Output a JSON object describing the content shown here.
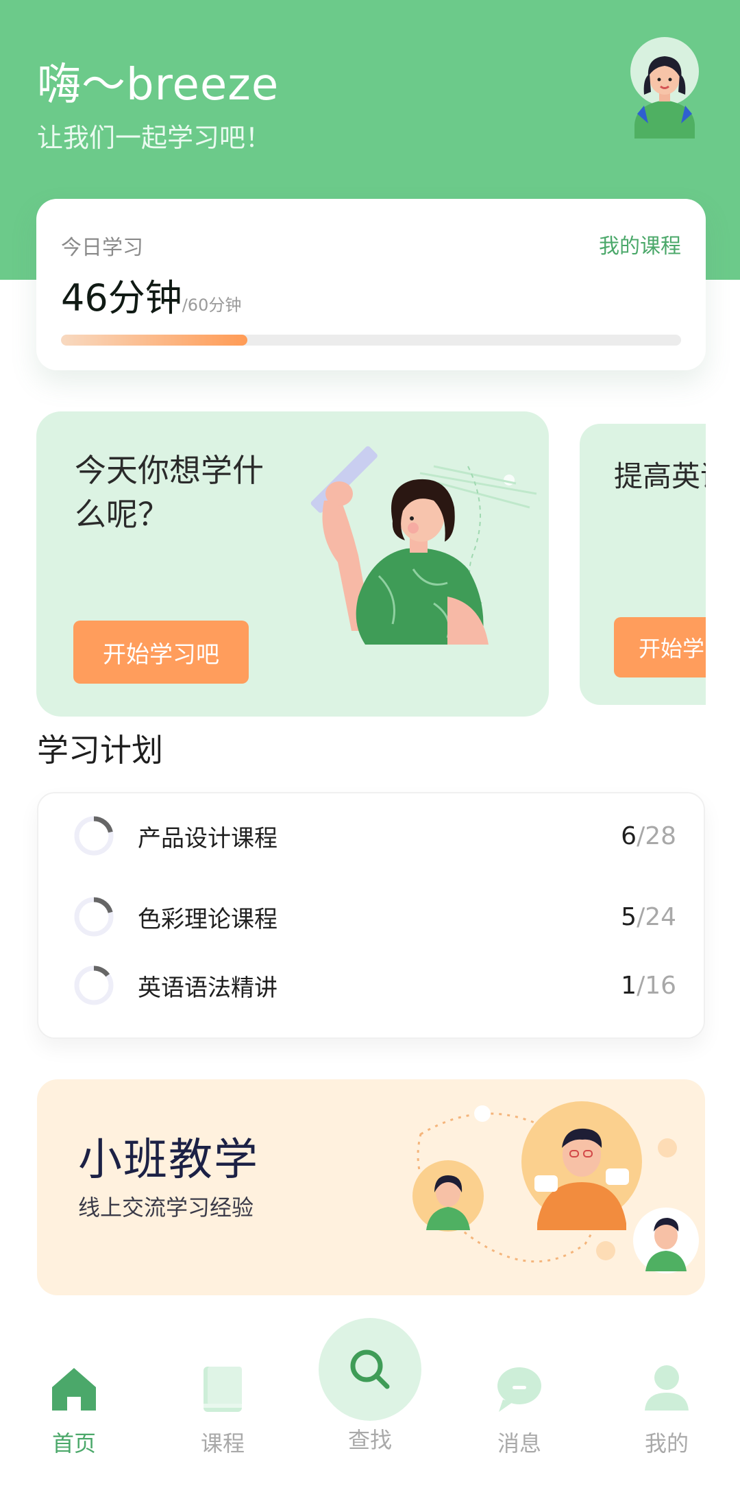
{
  "header": {
    "greeting": "嗨～breeze",
    "subtitle": "让我们一起学习吧！"
  },
  "today": {
    "label": "今日学习",
    "link": "我的课程",
    "minutes": "46分钟",
    "goal": "/60分钟",
    "progress_fraction": 0.3
  },
  "banners": [
    {
      "title": "今天你想学什么呢？",
      "button": "开始学习吧"
    },
    {
      "title": "提高英语从现在",
      "button": "开始学习"
    }
  ],
  "plan": {
    "heading": "学习计划",
    "items": [
      {
        "name": "产品设计课程",
        "done": "6",
        "total": "/28"
      },
      {
        "name": "色彩理论课程",
        "done": "5",
        "total": "/24"
      },
      {
        "name": "英语语法精讲",
        "done": "1",
        "total": "/16"
      }
    ]
  },
  "small_class": {
    "title": "小班教学",
    "subtitle": "线上交流学习经验"
  },
  "tabbar": {
    "home": "首页",
    "courses": "课程",
    "search": "查找",
    "messages": "消息",
    "profile": "我的"
  },
  "colors": {
    "brand_green": "#6cca8a",
    "accent_orange": "#ff9d5c",
    "banner_green": "#dcf3e3",
    "banner_cream": "#fff1de"
  },
  "icons": [
    "avatar",
    "home-icon",
    "book-icon",
    "search-icon",
    "chat-icon",
    "user-icon"
  ]
}
